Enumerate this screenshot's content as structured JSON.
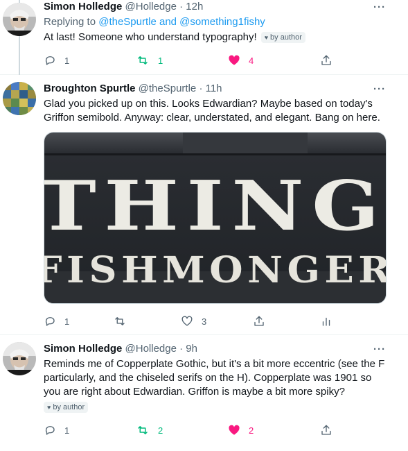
{
  "tweets": [
    {
      "name": "Simon Holledge",
      "handle": "@Holledge",
      "time": "· 12h",
      "reply_prefix": "Replying to ",
      "reply_mentions": "@theSpurtle and @something1fishy",
      "text": "At last! Someone who understand typography!",
      "badge": "by author",
      "more": "···",
      "replies": "1",
      "retweets": "1",
      "likes": "4",
      "liked": true,
      "retweeted": true
    },
    {
      "name": "Broughton Spurtle",
      "handle": "@theSpurtle",
      "time": "· 11h",
      "text": "Glad you picked up on this. Looks Edwardian? Maybe based on today's Griffon semibold. Anyway: clear, understated, and elegant. Bang on here.",
      "more": "···",
      "replies": "1",
      "retweets": "",
      "likes": "3",
      "liked": false,
      "retweeted": false,
      "media": {
        "line1": "THING",
        "line2": "FISHMONGER"
      }
    },
    {
      "name": "Simon Holledge",
      "handle": "@Holledge",
      "time": "· 9h",
      "text": "Reminds me of Copperplate Gothic, but it's a bit more eccentric (see the F particularly, and the chiseled serifs on the H). Copperplate was 1901 so you are right about Edwardian. Griffon is maybe a bit more spiky?",
      "badge": "by author",
      "more": "···",
      "replies": "1",
      "retweets": "2",
      "likes": "2",
      "liked": true,
      "retweeted": true
    }
  ],
  "colors": {
    "link": "#1d9bf0",
    "retweet_active": "#00ba7c",
    "like_active": "#f91880",
    "muted": "#536471"
  },
  "icons": [
    "reply-icon",
    "retweet-icon",
    "heart-icon",
    "share-icon",
    "analytics-icon",
    "more-icon"
  ]
}
